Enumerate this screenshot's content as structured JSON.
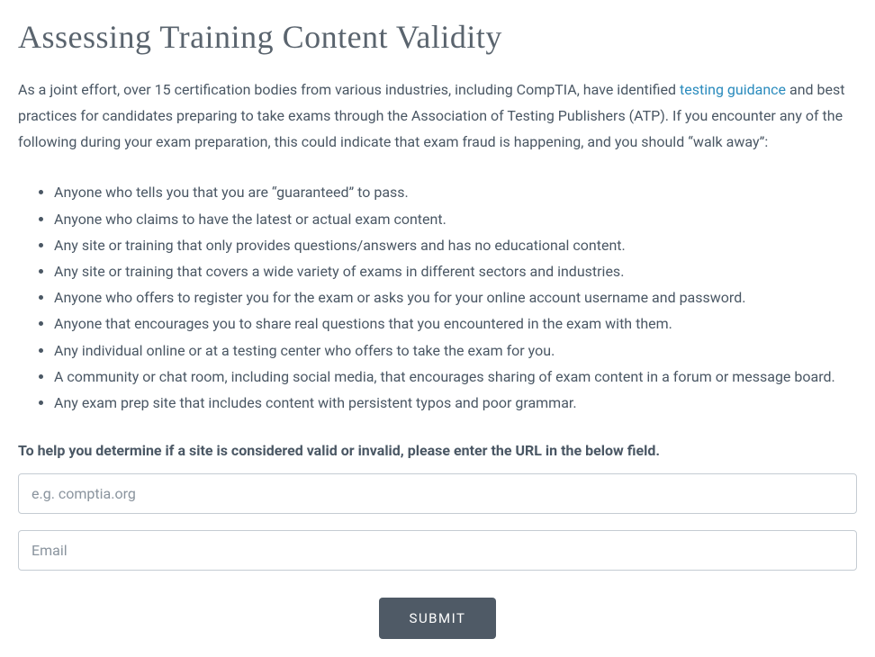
{
  "heading": "Assessing Training Content Validity",
  "intro": {
    "part1": "As a joint effort, over 15 certification bodies from various industries, including CompTIA, have identified ",
    "link_text": "testing guidance",
    "part2": " and best practices for candidates preparing to take exams through the Association of Testing Publishers (ATP). If you encounter any of the following during your exam preparation, this could indicate that exam fraud is happening, and you should “walk away”:"
  },
  "warnings": [
    "Anyone who tells you that you are “guaranteed” to pass.",
    "Anyone who claims to have the latest or actual exam content.",
    "Any site or training that only provides questions/answers and has no educational content.",
    "Any site or training that covers a wide variety of exams in different sectors and industries.",
    "Anyone who offers to register you for the exam or asks you for your online account username and password.",
    "Anyone that encourages you to share real questions that you encountered in the exam with them.",
    "Any individual online or at a testing center who offers to take the exam for you.",
    "A community or chat room, including social media, that encourages sharing of exam content in a forum or message board.",
    "Any exam prep site that includes content with persistent typos and poor grammar."
  ],
  "prompt": "To help you determine if a site is considered valid or invalid, please enter the URL in the below field.",
  "form": {
    "url_placeholder": "e.g. comptia.org",
    "email_placeholder": "Email",
    "submit_label": "SUBMIT"
  }
}
